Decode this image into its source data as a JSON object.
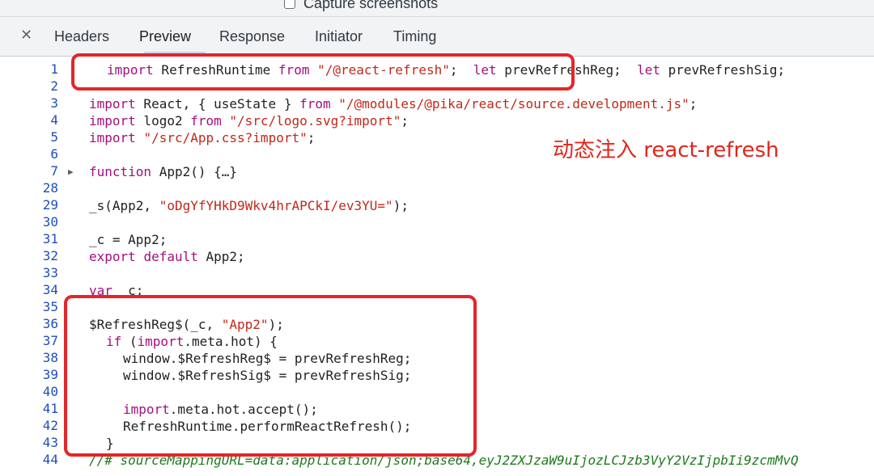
{
  "toolbar": {
    "capture_label": "Capture screenshots"
  },
  "tabs": [
    "Headers",
    "Preview",
    "Response",
    "Initiator",
    "Timing"
  ],
  "annotation": "动态注入 react-refresh",
  "code": {
    "line_numbers": [
      "1",
      "2",
      "3",
      "4",
      "5",
      "6",
      "7",
      "28",
      "29",
      "30",
      "31",
      "32",
      "33",
      "34",
      "35",
      "36",
      "37",
      "38",
      "39",
      "40",
      "41",
      "42",
      "43",
      "44"
    ]
  },
  "colors": {
    "highlight_box": "#e3262a",
    "annotation": "#e1251b",
    "keyword": "#a30e7f",
    "string": "#c1281a",
    "line_number": "#1f4fb8",
    "comment": "#1e7a1e"
  }
}
